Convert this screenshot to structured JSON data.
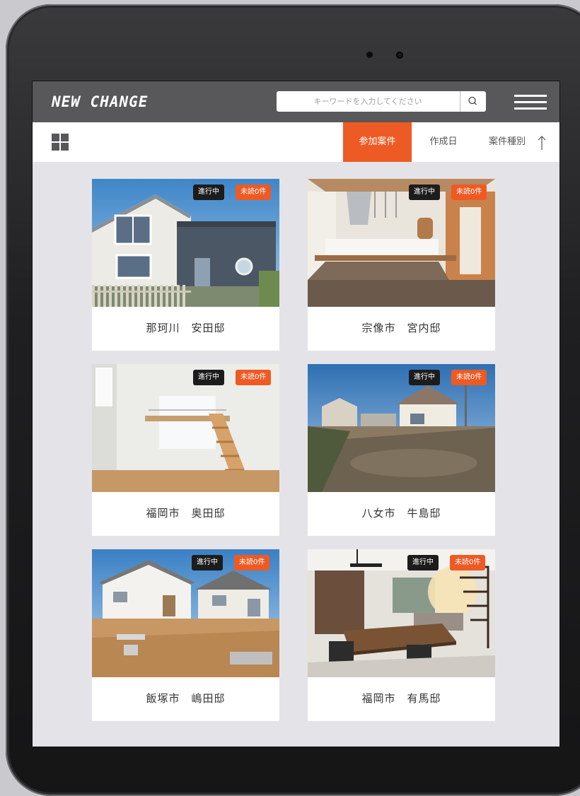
{
  "app": {
    "logo": "NEW CHANGE"
  },
  "search": {
    "placeholder": "キーワードを入力してください"
  },
  "icons": {
    "search": "search-icon",
    "menu": "hamburger-menu-icon",
    "view": "grid-view-icon",
    "sort": "sort-arrow-up-icon"
  },
  "colors": {
    "accent": "#ee5a24",
    "header": "#58585b"
  },
  "tabs": [
    {
      "label": "参加案件",
      "active": true
    },
    {
      "label": "作成日",
      "active": false
    },
    {
      "label": "案件種別",
      "active": false
    }
  ],
  "projects": [
    {
      "title": "那珂川　安田邸",
      "status": "進行中",
      "unread": "未読0件"
    },
    {
      "title": "宗像市　宮内邸",
      "status": "進行中",
      "unread": "未読0件"
    },
    {
      "title": "福岡市　奥田邸",
      "status": "進行中",
      "unread": "未読0件"
    },
    {
      "title": "八女市　牛島邸",
      "status": "進行中",
      "unread": "未読0件"
    },
    {
      "title": "飯塚市　嶋田邸",
      "status": "進行中",
      "unread": "未読0件"
    },
    {
      "title": "福岡市　有馬邸",
      "status": "進行中",
      "unread": "未読0件"
    }
  ]
}
